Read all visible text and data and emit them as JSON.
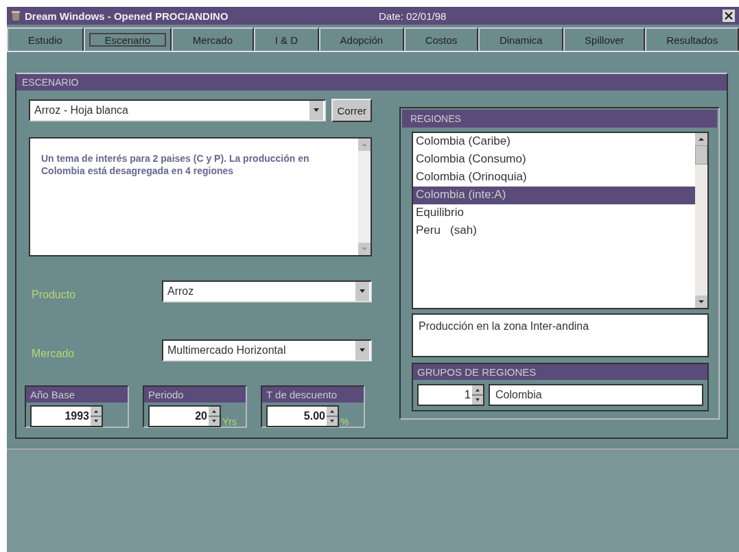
{
  "window": {
    "title": "Dream Windows - Opened PROCIANDINO",
    "date": "Date: 02/01/98"
  },
  "tabs": [
    {
      "label": "Estudio",
      "selected": false
    },
    {
      "label": "Escenario",
      "selected": true
    },
    {
      "label": "Mercado",
      "selected": false
    },
    {
      "label": "I & D",
      "selected": false
    },
    {
      "label": "Adopción",
      "selected": false
    },
    {
      "label": "Costos",
      "selected": false
    },
    {
      "label": "Dinamica",
      "selected": false
    },
    {
      "label": "Spillover",
      "selected": false
    },
    {
      "label": "Resultados",
      "selected": false
    }
  ],
  "scenario": {
    "header": "ESCENARIO",
    "select_value": "Arroz - Hoja blanca",
    "run_button": "Correr",
    "description": "Un tema de interés para 2 paises (C y P). La producción en Colombia está desagregada en 4 regiones",
    "fields": [
      {
        "label": "Producto",
        "value": "Arroz"
      },
      {
        "label": "Mercado",
        "value": "Multimercado Horizontal"
      }
    ],
    "spinners": [
      {
        "label": "Año Base",
        "value": "1993"
      },
      {
        "label": "Periodo",
        "value": "20",
        "unit": "Yrs"
      },
      {
        "label": "T de descuento",
        "value": "5.00",
        "unit": "%"
      }
    ]
  },
  "regions": {
    "header": "REGIONES",
    "items": [
      {
        "label": "Colombia (Caribe)",
        "selected": false
      },
      {
        "label": "Colombia (Consumo)",
        "selected": false
      },
      {
        "label": "Colombia (Orinoquia)",
        "selected": false
      },
      {
        "label": "Colombia (inte:A)",
        "selected": true
      },
      {
        "label": "Equilibrio",
        "selected": false
      },
      {
        "label": "Peru   (sah)",
        "selected": false
      }
    ],
    "description": "Producción en la zona Inter-andina",
    "groups": {
      "header": "GRUPOS DE REGIONES",
      "number": "1",
      "name": "Colombia"
    }
  }
}
